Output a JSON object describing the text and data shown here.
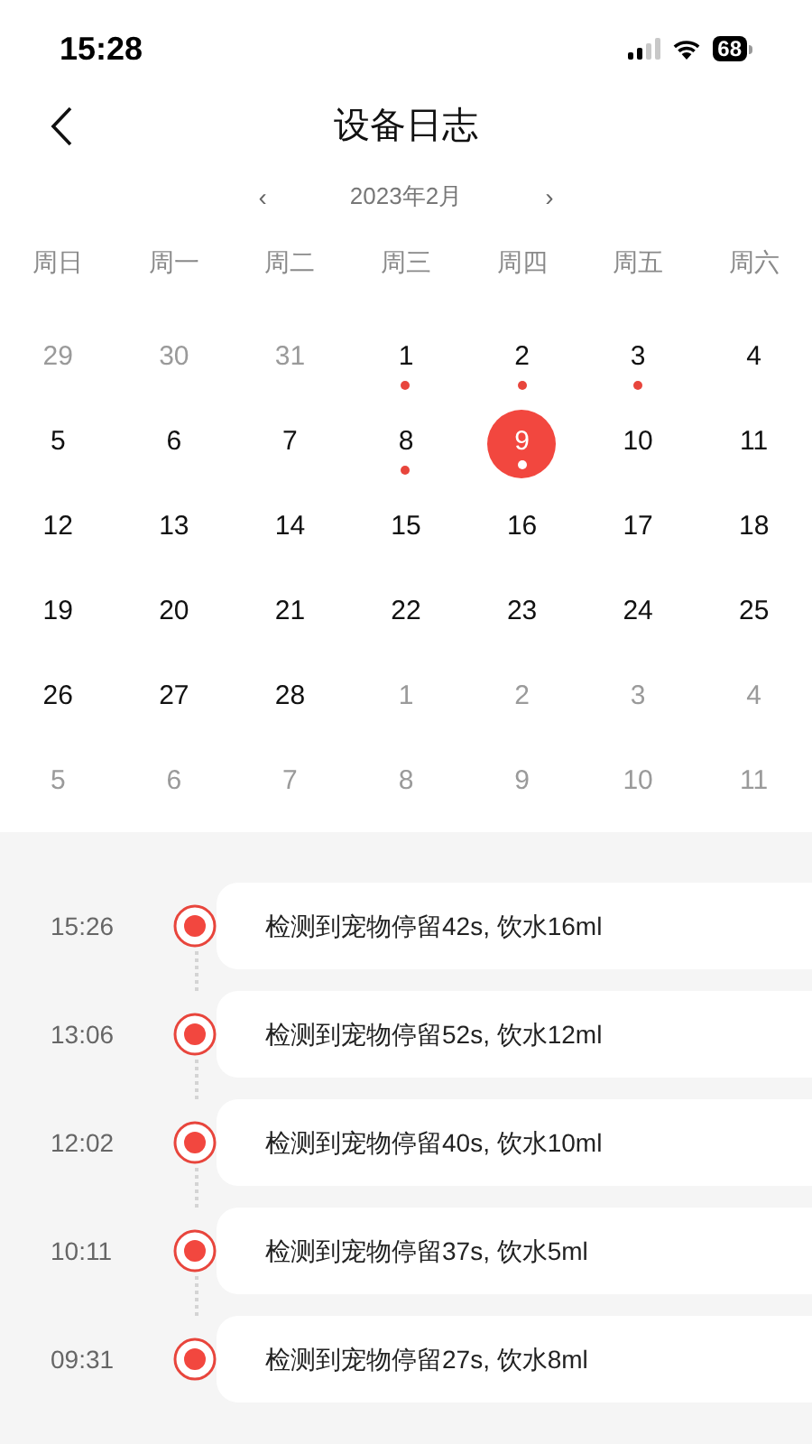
{
  "status_bar": {
    "time": "15:28",
    "battery": "68"
  },
  "header": {
    "title": "设备日志"
  },
  "month_nav": {
    "prev": "‹",
    "label": "2023年2月",
    "next": "›"
  },
  "weekdays": [
    "周日",
    "周一",
    "周二",
    "周三",
    "周四",
    "周五",
    "周六"
  ],
  "days": [
    {
      "label": "29",
      "muted": true,
      "dot": false,
      "selected": false
    },
    {
      "label": "30",
      "muted": true,
      "dot": false,
      "selected": false
    },
    {
      "label": "31",
      "muted": true,
      "dot": false,
      "selected": false
    },
    {
      "label": "1",
      "muted": false,
      "dot": true,
      "selected": false
    },
    {
      "label": "2",
      "muted": false,
      "dot": true,
      "selected": false
    },
    {
      "label": "3",
      "muted": false,
      "dot": true,
      "selected": false
    },
    {
      "label": "4",
      "muted": false,
      "dot": false,
      "selected": false
    },
    {
      "label": "5",
      "muted": false,
      "dot": false,
      "selected": false
    },
    {
      "label": "6",
      "muted": false,
      "dot": false,
      "selected": false
    },
    {
      "label": "7",
      "muted": false,
      "dot": false,
      "selected": false
    },
    {
      "label": "8",
      "muted": false,
      "dot": true,
      "selected": false
    },
    {
      "label": "9",
      "muted": false,
      "dot": true,
      "selected": true
    },
    {
      "label": "10",
      "muted": false,
      "dot": false,
      "selected": false
    },
    {
      "label": "11",
      "muted": false,
      "dot": false,
      "selected": false
    },
    {
      "label": "12",
      "muted": false,
      "dot": false,
      "selected": false
    },
    {
      "label": "13",
      "muted": false,
      "dot": false,
      "selected": false
    },
    {
      "label": "14",
      "muted": false,
      "dot": false,
      "selected": false
    },
    {
      "label": "15",
      "muted": false,
      "dot": false,
      "selected": false
    },
    {
      "label": "16",
      "muted": false,
      "dot": false,
      "selected": false
    },
    {
      "label": "17",
      "muted": false,
      "dot": false,
      "selected": false
    },
    {
      "label": "18",
      "muted": false,
      "dot": false,
      "selected": false
    },
    {
      "label": "19",
      "muted": false,
      "dot": false,
      "selected": false
    },
    {
      "label": "20",
      "muted": false,
      "dot": false,
      "selected": false
    },
    {
      "label": "21",
      "muted": false,
      "dot": false,
      "selected": false
    },
    {
      "label": "22",
      "muted": false,
      "dot": false,
      "selected": false
    },
    {
      "label": "23",
      "muted": false,
      "dot": false,
      "selected": false
    },
    {
      "label": "24",
      "muted": false,
      "dot": false,
      "selected": false
    },
    {
      "label": "25",
      "muted": false,
      "dot": false,
      "selected": false
    },
    {
      "label": "26",
      "muted": false,
      "dot": false,
      "selected": false
    },
    {
      "label": "27",
      "muted": false,
      "dot": false,
      "selected": false
    },
    {
      "label": "28",
      "muted": false,
      "dot": false,
      "selected": false
    },
    {
      "label": "1",
      "muted": true,
      "dot": false,
      "selected": false
    },
    {
      "label": "2",
      "muted": true,
      "dot": false,
      "selected": false
    },
    {
      "label": "3",
      "muted": true,
      "dot": false,
      "selected": false
    },
    {
      "label": "4",
      "muted": true,
      "dot": false,
      "selected": false
    },
    {
      "label": "5",
      "muted": true,
      "dot": false,
      "selected": false
    },
    {
      "label": "6",
      "muted": true,
      "dot": false,
      "selected": false
    },
    {
      "label": "7",
      "muted": true,
      "dot": false,
      "selected": false
    },
    {
      "label": "8",
      "muted": true,
      "dot": false,
      "selected": false
    },
    {
      "label": "9",
      "muted": true,
      "dot": false,
      "selected": false
    },
    {
      "label": "10",
      "muted": true,
      "dot": false,
      "selected": false
    },
    {
      "label": "11",
      "muted": true,
      "dot": false,
      "selected": false
    }
  ],
  "logs": [
    {
      "time": "15:26",
      "text": "检测到宠物停留42s, 饮水16ml"
    },
    {
      "time": "13:06",
      "text": "检测到宠物停留52s, 饮水12ml"
    },
    {
      "time": "12:02",
      "text": "检测到宠物停留40s, 饮水10ml"
    },
    {
      "time": "10:11",
      "text": "检测到宠物停留37s, 饮水5ml"
    },
    {
      "time": "09:31",
      "text": "检测到宠物停留27s, 饮水8ml"
    }
  ]
}
